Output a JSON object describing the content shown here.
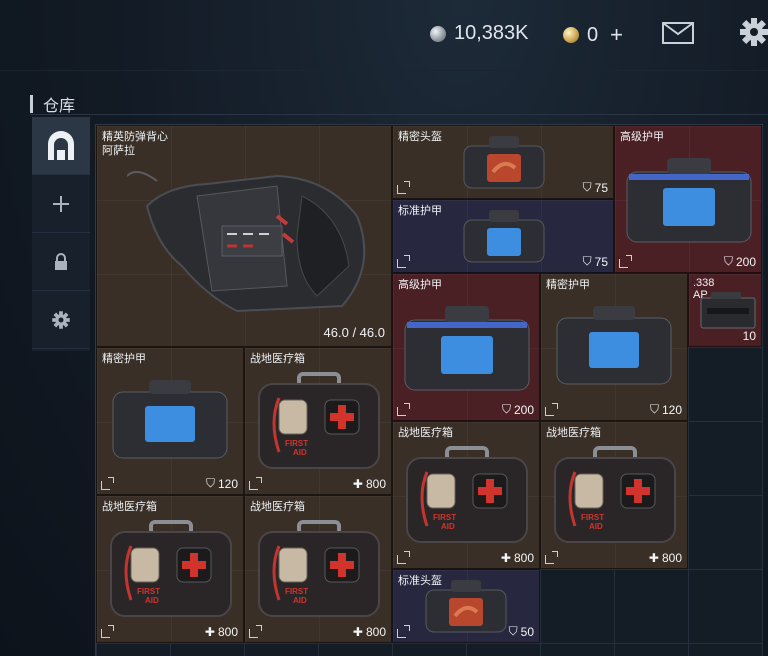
{
  "topbar": {
    "silver_amount": "10,383K",
    "gold_amount": "0",
    "gold_plus": "+",
    "icons": [
      "silver-coin-icon",
      "gold-coin-icon",
      "mail-icon",
      "gear-icon"
    ]
  },
  "section": {
    "title": "仓库"
  },
  "sidetabs": {
    "items": [
      {
        "name": "warehouse-tab",
        "icon": "warehouse-icon",
        "active": true
      },
      {
        "name": "add-tab",
        "icon": "plus-icon",
        "label": "+"
      },
      {
        "name": "lock-tab",
        "icon": "lock-icon"
      },
      {
        "name": "settings-tab",
        "icon": "gear-icon"
      }
    ]
  },
  "items": {
    "vest": {
      "name_line1": "精英防弹背心",
      "name_line2": "阿萨拉",
      "durability": "46.0 / 46.0",
      "rarity_color": "#3a2f26"
    },
    "helmet_top": {
      "name": "精密头盔",
      "stat": "75",
      "stat_icon": "shield-icon"
    },
    "armor_adv_1": {
      "name": "高级护甲",
      "stat": "200",
      "stat_icon": "shield-icon"
    },
    "helmet_std_1": {
      "name": "标准护甲",
      "stat": "75",
      "stat_icon": "shield-icon"
    },
    "armor_adv_2": {
      "name": "高级护甲",
      "stat": "200",
      "stat_icon": "shield-icon"
    },
    "armor_prec_1": {
      "name": "精密护甲",
      "stat": "120",
      "stat_icon": "shield-icon"
    },
    "ammo": {
      "name_line1": ".338",
      "name_line2": "AP",
      "count": "10"
    },
    "armor_prec_2": {
      "name": "精密护甲",
      "stat": "120",
      "stat_icon": "shield-icon"
    },
    "medkit_1": {
      "name": "战地医疗箱",
      "stat": "800",
      "stat_icon": "plus-icon"
    },
    "medkit_2": {
      "name": "战地医疗箱",
      "stat": "800",
      "stat_icon": "plus-icon"
    },
    "medkit_3": {
      "name": "战地医疗箱",
      "stat": "800",
      "stat_icon": "plus-icon"
    },
    "medkit_4": {
      "name": "战地医疗箱",
      "stat": "800",
      "stat_icon": "plus-icon"
    },
    "medkit_5": {
      "name": "战地医疗箱",
      "stat": "800",
      "stat_icon": "plus-icon"
    },
    "helmet_std_2": {
      "name": "标准头盔",
      "stat": "50",
      "stat_icon": "shield-icon"
    }
  },
  "glyphs": {
    "shield": "⛉",
    "plus": "✚",
    "first_aid_1": "FIRST",
    "first_aid_2": "AID"
  },
  "colors": {
    "rarity_red": "#4b2025",
    "rarity_navy": "#27283f",
    "rarity_brown": "#3a2f26",
    "accent_blue": "#3d8ee0"
  }
}
